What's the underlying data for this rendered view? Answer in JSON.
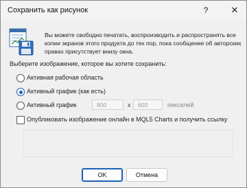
{
  "window": {
    "title": "Сохранить как рисунок",
    "help_glyph": "?",
    "close_glyph": "✕"
  },
  "intro_text": "Вы можете свободно печатать, воспроизводить и распространять все копии экранов этого продукта до тех пор, пока сообщение об авторских правах присутствует внизу окна.",
  "prompt": "Выберите изображение, которое вы хотите сохранить:",
  "options": [
    {
      "label": "Активная рабочая область",
      "checked": false
    },
    {
      "label": "Активный график (как есть)",
      "checked": true
    },
    {
      "label": "Активный график",
      "checked": false
    }
  ],
  "size": {
    "width_value": "800",
    "separator": "x",
    "height_value": "600",
    "unit": "пикселей"
  },
  "publish": {
    "label": "Опубликовать изображение онлайн в MQL5 Charts и получить ссылку",
    "checked": false
  },
  "buttons": {
    "ok": "OK",
    "cancel": "Отмена"
  },
  "icons": {
    "app": "save-picture-icon"
  },
  "colors": {
    "accent": "#1b5fb5",
    "dialog_bg": "#f0f0f0"
  }
}
